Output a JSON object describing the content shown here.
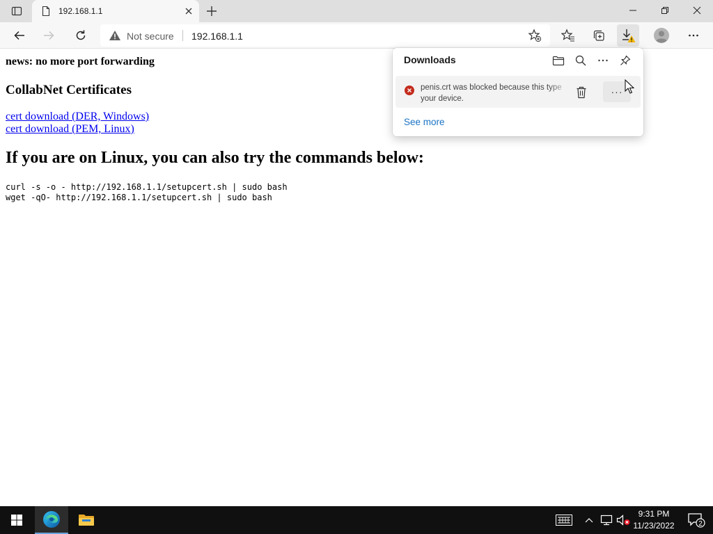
{
  "browser": {
    "tab": {
      "title": "192.168.1.1"
    },
    "address": {
      "security_label": "Not secure",
      "url": "192.168.1.1"
    }
  },
  "page": {
    "news": "news: no more port forwarding",
    "cert_heading": "CollabNet Certificates",
    "links": [
      {
        "label": "cert download (DER, Windows)"
      },
      {
        "label": "cert download (PEM, Linux)"
      }
    ],
    "linux_heading": "If you are on Linux, you can also try the commands below:",
    "commands": [
      "curl -s -o - http://192.168.1.1/setupcert.sh | sudo bash",
      "wget -qO- http://192.168.1.1/setupcert.sh | sudo bash"
    ]
  },
  "downloads": {
    "title": "Downloads",
    "item": {
      "message_line1": "penis.crt was blocked because this type",
      "message_line2": "your device.",
      "more_label": "···"
    },
    "see_more": "See more"
  },
  "taskbar": {
    "time": "9:31 PM",
    "date": "11/23/2022",
    "notification_count": "2"
  },
  "colors": {
    "tab_strip": "#dfdfdf",
    "toolbar": "#f7f7f7",
    "link": "#0000ee",
    "see_more": "#1a73c4",
    "error": "#c42b1c",
    "taskbar": "#101010"
  }
}
